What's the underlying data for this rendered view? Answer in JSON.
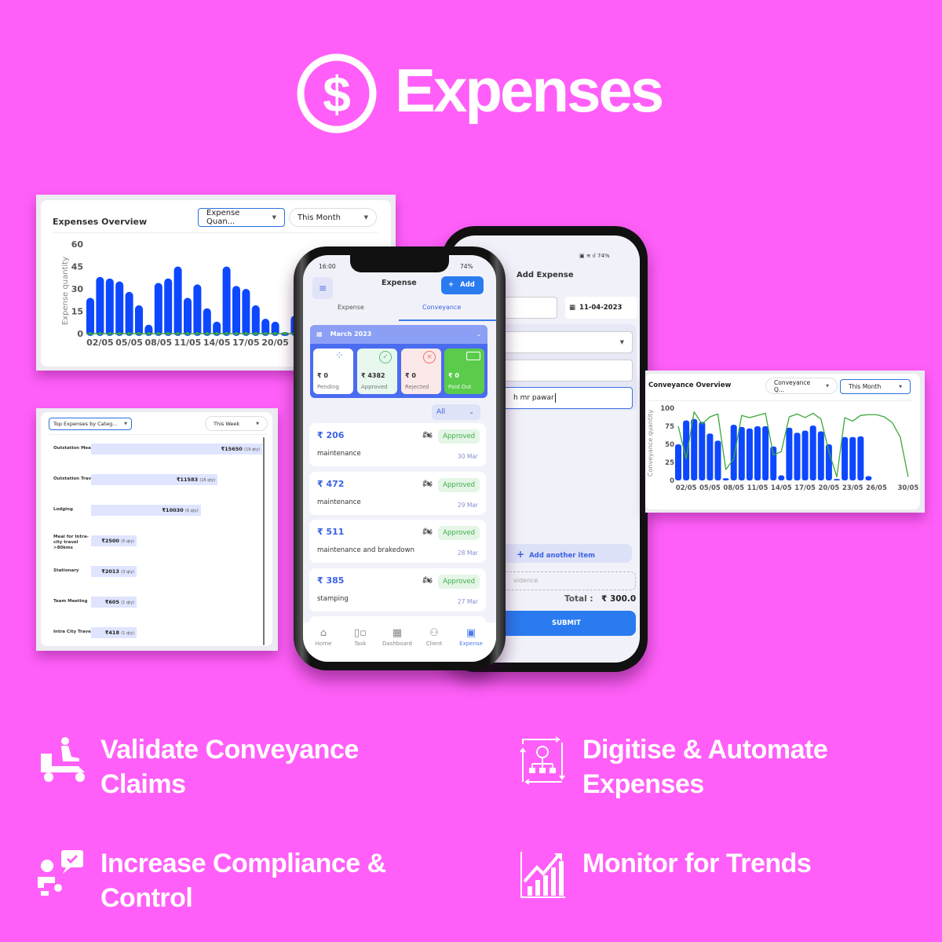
{
  "hero": {
    "title": "Expenses",
    "icon": "dollar-circle-icon"
  },
  "colors": {
    "background": "#ff5ff8",
    "bar": "#0d47ff",
    "line": "#3aa83a",
    "accent": "#2a7bf0",
    "paid": "#5bcb4c"
  },
  "expenses_overview": {
    "title": "Expenses Overview",
    "metric_select": "Expense Quan...",
    "period_select": "This Month",
    "chart_data": {
      "type": "bar",
      "ylabel": "Expense quantity",
      "ylim": [
        0,
        60
      ],
      "yticks": [
        "0",
        "15",
        "30",
        "45",
        "60"
      ],
      "xticks": [
        "02/05",
        "05/05",
        "08/05",
        "11/05",
        "14/05",
        "17/05",
        "20/05"
      ],
      "x": [
        "01/05",
        "02/05",
        "03/05",
        "04/05",
        "05/05",
        "06/05",
        "07/05",
        "08/05",
        "09/05",
        "10/05",
        "11/05",
        "12/05",
        "13/05",
        "14/05",
        "15/05",
        "16/05",
        "17/05",
        "18/05",
        "19/05",
        "20/05",
        "21/05",
        "22/05"
      ],
      "values": [
        24,
        38,
        37,
        35,
        28,
        19,
        6,
        34,
        37,
        45,
        24,
        33,
        17,
        8,
        45,
        32,
        30,
        19,
        10,
        8,
        1,
        12
      ]
    }
  },
  "top_expenses": {
    "category_select": "Top Expenses by Categ...",
    "period_select": "This Week",
    "chart_data": {
      "type": "bar",
      "orientation": "horizontal",
      "items": [
        {
          "label": "Outstation Meal",
          "amount": "₹15650",
          "qty": "(19 qty)",
          "value": 15650
        },
        {
          "label": "Outstation Travel",
          "amount": "₹11583",
          "qty": "(16 qty)",
          "value": 11583
        },
        {
          "label": "Lodging",
          "amount": "₹10030",
          "qty": "(6 qty)",
          "value": 10030
        },
        {
          "label": "Meal for Intra-city travel >80kms",
          "amount": "₹2500",
          "qty": "(5 qty)",
          "value": 2500
        },
        {
          "label": "Stationary",
          "amount": "₹2013",
          "qty": "(3 qty)",
          "value": 2013
        },
        {
          "label": "Team Meeting",
          "amount": "₹605",
          "qty": "(1 qty)",
          "value": 605
        },
        {
          "label": "Intra City Travel",
          "amount": "₹418",
          "qty": "(1 qty)",
          "value": 418
        }
      ]
    }
  },
  "conveyance_overview": {
    "title": "Conveyance Overview",
    "metric_select": "Conveyance Q...",
    "period_select": "This Month",
    "chart_data": {
      "type": "bar+line",
      "ylabel": "Conveyance quantity",
      "ylim": [
        0,
        100
      ],
      "yticks": [
        "0",
        "25",
        "50",
        "75",
        "100"
      ],
      "xticks": [
        "02/05",
        "05/05",
        "08/05",
        "11/05",
        "14/05",
        "17/05",
        "20/05",
        "23/05",
        "26/05",
        "30/05"
      ],
      "bar_values": [
        50,
        83,
        85,
        81,
        65,
        55,
        3,
        77,
        74,
        72,
        75,
        75,
        47,
        7,
        73,
        66,
        69,
        76,
        68,
        50,
        2,
        60,
        60,
        61,
        6
      ],
      "line_values": [
        75,
        30,
        95,
        78,
        88,
        92,
        15,
        30,
        90,
        87,
        90,
        93,
        35,
        40,
        88,
        92,
        87,
        93,
        85,
        40,
        5,
        87,
        82,
        90,
        91,
        91,
        88,
        80,
        60,
        5
      ]
    }
  },
  "phone_main": {
    "status_time": "16:00",
    "status_battery": "74%",
    "title": "Expense",
    "add_label": "Add",
    "tabs": [
      {
        "label": "Expense",
        "active": false
      },
      {
        "label": "Conveyance",
        "active": true
      }
    ],
    "month": "March  2023",
    "summary": [
      {
        "amount": "₹ 0",
        "label": "Pending"
      },
      {
        "amount": "₹ 4382",
        "label": "Approved"
      },
      {
        "amount": "₹ 0",
        "label": "Rejected"
      },
      {
        "amount": "₹ 0",
        "label": "Paid Out"
      }
    ],
    "filter": "All",
    "items": [
      {
        "amount": "₹ 206",
        "desc": "maintenance",
        "date": "30 Mar",
        "status": "Approved"
      },
      {
        "amount": "₹ 472",
        "desc": "maintenance",
        "date": "29 Mar",
        "status": "Approved"
      },
      {
        "amount": "₹ 511",
        "desc": "maintenance and brakedown",
        "date": "28 Mar",
        "status": "Approved"
      },
      {
        "amount": "₹ 385",
        "desc": "stamping",
        "date": "27 Mar",
        "status": "Approved"
      }
    ],
    "nav": [
      {
        "label": "Home",
        "icon": "home-icon"
      },
      {
        "label": "Task",
        "icon": "task-icon"
      },
      {
        "label": "Dashboard",
        "icon": "calendar-icon"
      },
      {
        "label": "Client",
        "icon": "user-icon"
      },
      {
        "label": "Expense",
        "icon": "wallet-icon",
        "active": true
      }
    ]
  },
  "phone_add": {
    "status_battery": "74%",
    "title": "Add Expense",
    "date": "11-04-2023",
    "note_value": "h mr pawar",
    "add_item": "Add another item",
    "evidence": "vidence",
    "total_label": "Total :",
    "total_value": "₹ 300.0",
    "submit": "SUBMIT"
  },
  "features": [
    {
      "text": "Validate Conveyance Claims",
      "icon": "scooter-rider-icon"
    },
    {
      "text": "Digitise & Automate Expenses",
      "icon": "automation-gear-icon"
    },
    {
      "text": "Increase Compliance & Control",
      "icon": "compliance-person-icon"
    },
    {
      "text": "Monitor for Trends",
      "icon": "trend-chart-icon"
    }
  ]
}
